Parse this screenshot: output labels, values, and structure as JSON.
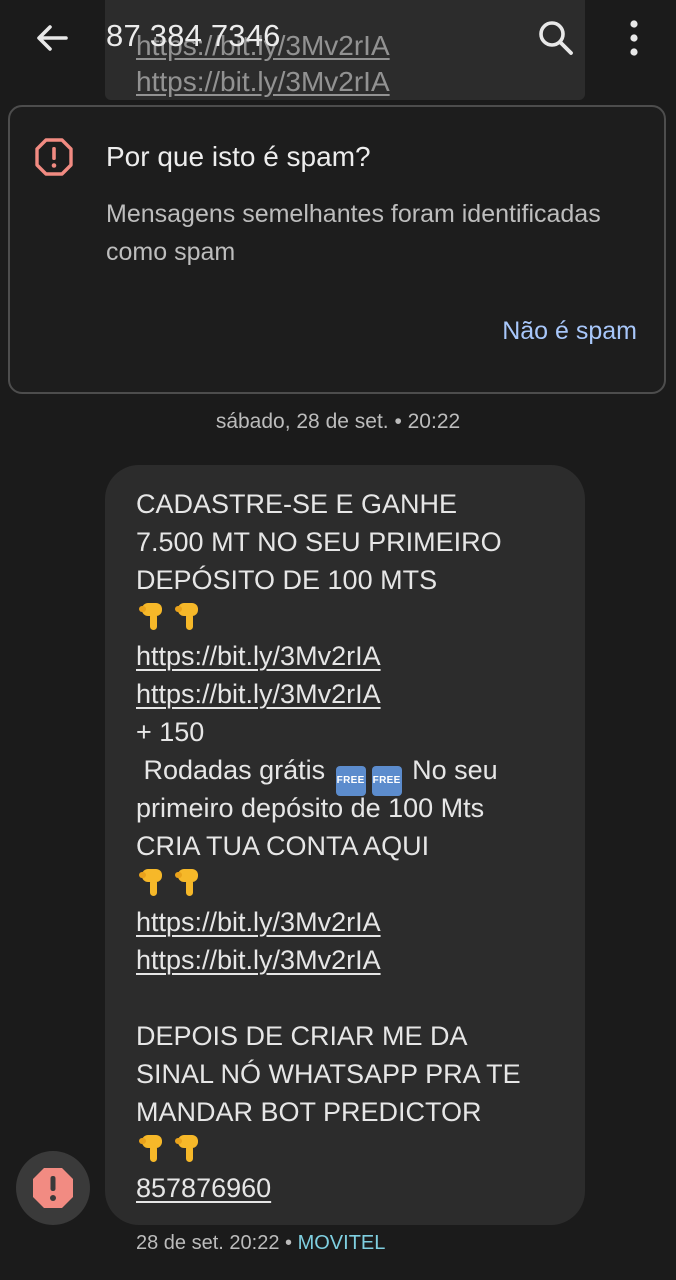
{
  "header": {
    "title": "87 384 7346",
    "back_icon": "arrow-back-icon",
    "search_icon": "search-icon",
    "menu_icon": "more-vert-icon"
  },
  "previous_message": {
    "links": [
      "https://bit.ly/3Mv2rIA",
      "https://bit.ly/3Mv2rIA"
    ]
  },
  "spam_card": {
    "title": "Por que isto é spam?",
    "description": "Mensagens semelhantes foram identificadas como spam",
    "not_spam_label": "Não é spam",
    "icon": "warning-octagon-icon",
    "accent_color": "#f28b82",
    "link_color": "#a8c7fa"
  },
  "date_divider": "sábado, 28 de set. • 20:22",
  "message": {
    "line1": "CADASTRE-SE E GANHE",
    "line2": "7.500 MT NO SEU PRIMEIRO",
    "line3": "DEPÓSITO DE 100 MTS",
    "link1": "https://bit.ly/3Mv2rIA",
    "link2": "https://bit.ly/3Mv2rIA",
    "line_plus": "+ 150",
    "line_rodadas_a": " Rodadas grátis ",
    "line_rodadas_b": " No seu",
    "free_badge": "FREE",
    "line_primeiro": "primeiro depósito de 100 Mts",
    "line_cria": "CRIA TUA CONTA AQUI",
    "link3": "https://bit.ly/3Mv2rIA",
    "link4": "https://bit.ly/3Mv2rIA",
    "line_depois1": "DEPOIS DE CRIAR ME DA",
    "line_depois2": "SINAL NÓ WHATSAPP PRA TE",
    "line_depois3": "MANDAR BOT PREDICTOR",
    "phone": "857876960",
    "emoji": "pointing-down-hand-icon"
  },
  "meta": {
    "timestamp": "28 de set. 20:22",
    "separator": " • ",
    "carrier": "MOVITEL"
  },
  "fab": {
    "icon": "report-spam-icon",
    "color": "#f28b82"
  }
}
